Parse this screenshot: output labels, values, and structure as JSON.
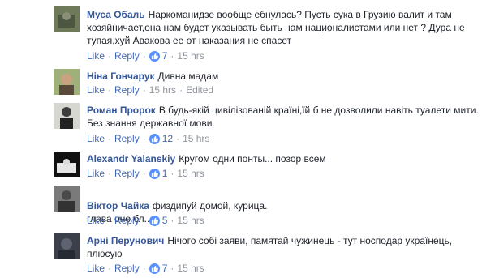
{
  "comments": [
    {
      "author": "Муса Обаль",
      "text": "Наркоманидзе вообще ебнулась? Пусть сука в Грузию валит и там хозяйничает,она нам будет указывать быть нам националистами или нет ? Дура не тупая,хуй Авакова ее от наказания не спасет",
      "like_label": "Like",
      "reply_label": "Reply",
      "likes": "7",
      "time": "15 hrs",
      "edited": ""
    },
    {
      "author": "Ніна Гончарук",
      "text": "Дивна мадам",
      "like_label": "Like",
      "reply_label": "Reply",
      "likes": "",
      "time": "15 hrs",
      "edited": "Edited"
    },
    {
      "author": "Роман Пророк",
      "text": "В будь-якій цивілізованій країні,їй б не дозволили навіть туалети мити. Без знання державної мови.",
      "like_label": "Like",
      "reply_label": "Reply",
      "likes": "12",
      "time": "15 hrs",
      "edited": ""
    },
    {
      "author": "Alexandr Yalanskiy",
      "text": "Кругом одни понты... позор всем",
      "like_label": "Like",
      "reply_label": "Reply",
      "likes": "1",
      "time": "15 hrs",
      "edited": ""
    },
    {
      "author": "Віктор Чайка",
      "text": "физдипуй домой, курица.\nглава оно бл...",
      "like_label": "Like",
      "reply_label": "Reply",
      "likes": "5",
      "time": "15 hrs",
      "edited": ""
    },
    {
      "author": "Арні Перунович",
      "text": "Нічого собі заяви, памятай чужинець - тут носподар українець, плюсую",
      "like_label": "Like",
      "reply_label": "Reply",
      "likes": "7",
      "time": "15 hrs",
      "edited": ""
    }
  ],
  "colors": {
    "author": "#365899",
    "link": "#4267b2",
    "meta": "#90949c",
    "like_badge": "#5890ff"
  },
  "icons": [
    "like-thumb-icon"
  ]
}
